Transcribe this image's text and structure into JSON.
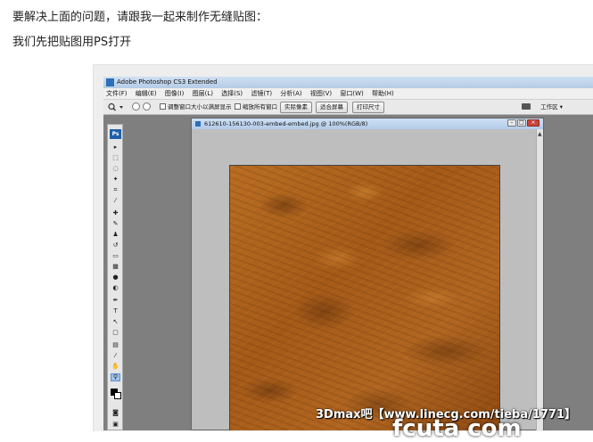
{
  "article": {
    "line1": "要解决上面的问题，请跟我一起来制作无缝贴图：",
    "line2": "我们先把贴图用PS打开"
  },
  "photoshop": {
    "app_title": "Adobe Photoshop CS3 Extended",
    "menu": [
      "文件(F)",
      "编辑(E)",
      "图像(I)",
      "图层(L)",
      "选择(S)",
      "滤镜(T)",
      "分析(A)",
      "视图(V)",
      "窗口(W)",
      "帮助(H)"
    ],
    "options": {
      "resize_window_label": "调整窗口大小以满屏显示",
      "zoom_all_label": "缩放所有窗口",
      "actual_pixels": "实际像素",
      "fit_screen": "适合屏幕",
      "print_size": "打印尺寸",
      "workspace": "工作区 ▾"
    },
    "toolbox_logo": "Ps",
    "document": {
      "title": "612610-156130-003-embed-embed.jpg @ 100%(RGB/8)"
    }
  },
  "watermark": {
    "text": "3Dmax吧【www.linecg.com/tieba/1771】",
    "fragment": "fcuta com"
  },
  "icons": {
    "zoom_tool": "magnifier-icon",
    "camera": "camera-icon",
    "close": "close-icon"
  }
}
